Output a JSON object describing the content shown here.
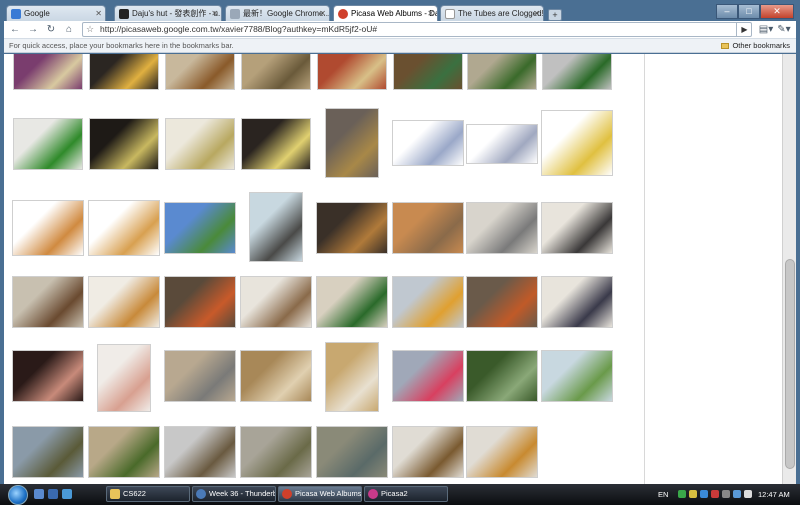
{
  "tabs": [
    {
      "label": "Google",
      "favicon_color": "#3a7bd5"
    },
    {
      "label": "Daju's hut - 發表創作 - u...",
      "favicon_color": "#222222"
    },
    {
      "label": "最新！Google Chrome...",
      "favicon_color": "#9aa8b8"
    },
    {
      "label": "Picasa Web Albums - Daj...",
      "favicon_color": "#d0402b"
    },
    {
      "label": "The Tubes are Clogged!",
      "favicon_color": "#cccccc"
    }
  ],
  "new_tab_symbol": "+",
  "window_controls": {
    "minimize": "–",
    "maximize": "□",
    "close": "✕"
  },
  "nav": {
    "back": "←",
    "forward": "→",
    "reload": "↻",
    "home": "⌂"
  },
  "omnibox": {
    "url": "http://picasaweb.google.com.tw/xavier7788/Blog?authkey=mKdR5jf2-oU#",
    "star": "☆",
    "go": "▶"
  },
  "toolbar_icons": {
    "page": "▤▾",
    "tools": "✎▾"
  },
  "bookmarks_bar": {
    "hint": "For quick access, place your bookmarks here in the bookmarks bar.",
    "other": "Other bookmarks"
  },
  "photos": [
    {
      "c1": "#7a3d6e",
      "c2": "#d8c9a0"
    },
    {
      "c1": "#2b2622",
      "c2": "#e0b040"
    },
    {
      "c1": "#c8b89c",
      "c2": "#8a5a2a"
    },
    {
      "c1": "#b5a07a",
      "c2": "#6a5a3a"
    },
    {
      "c1": "#b04a30",
      "c2": "#d8c088"
    },
    {
      "c1": "#6a5030",
      "c2": "#3a7040"
    },
    {
      "c1": "#b0a890",
      "c2": "#3a6a2a"
    },
    {
      "c1": "#c0c0c0",
      "c2": "#2a6a28"
    },
    {
      "c1": "#e8e8e4",
      "c2": "#2f8a2a"
    },
    {
      "c1": "#1e1a16",
      "c2": "#c8b860"
    },
    {
      "c1": "#ece8dc",
      "c2": "#b8a860"
    },
    {
      "c1": "#2a2420",
      "c2": "#e0d070"
    },
    {
      "c1": "#6a6058",
      "c2": "#a88848"
    },
    {
      "c1": "#ffffff",
      "c2": "#9aa8c8"
    },
    {
      "c1": "#ffffff",
      "c2": "#a0a8c0"
    },
    {
      "c1": "#ffffff",
      "c2": "#e0c040"
    },
    {
      "c1": "#ffffff",
      "c2": "#d08a40"
    },
    {
      "c1": "#ffffff",
      "c2": "#d8a050"
    },
    {
      "c1": "#5a8ad0",
      "c2": "#4a8a3a"
    },
    {
      "c1": "#c8d8e0",
      "c2": "#4a4a48"
    },
    {
      "c1": "#3a3028",
      "c2": "#b07a3a"
    },
    {
      "c1": "#c88a50",
      "c2": "#8a6a4a"
    },
    {
      "c1": "#d8d4cc",
      "c2": "#7a7a7a"
    },
    {
      "c1": "#e8e4dc",
      "c2": "#3a3838"
    },
    {
      "c1": "#c8c0b0",
      "c2": "#6a4a30"
    },
    {
      "c1": "#f0ece4",
      "c2": "#c88a3a"
    },
    {
      "c1": "#5a4a3a",
      "c2": "#c85a2a"
    },
    {
      "c1": "#e8e4dc",
      "c2": "#8a6a4a"
    },
    {
      "c1": "#d8d0c0",
      "c2": "#2a6a2a"
    },
    {
      "c1": "#c0c8d0",
      "c2": "#e0a030"
    },
    {
      "c1": "#6a5a4a",
      "c2": "#c05a28"
    },
    {
      "c1": "#e8e4dc",
      "c2": "#3a3a4a"
    },
    {
      "c1": "#2a1a18",
      "c2": "#c88a7a"
    },
    {
      "c1": "#f0ece8",
      "c2": "#d8a090"
    },
    {
      "c1": "#b8a890",
      "c2": "#7a7a78"
    },
    {
      "c1": "#a88858",
      "c2": "#e0d0b0"
    },
    {
      "c1": "#c8a870",
      "c2": "#e8e0d0"
    },
    {
      "c1": "#a0a8b8",
      "c2": "#d84060"
    },
    {
      "c1": "#3a5a2a",
      "c2": "#8aa878"
    },
    {
      "c1": "#c8d8e0",
      "c2": "#6a9a4a"
    },
    {
      "c1": "#8a9aa8",
      "c2": "#5a5a38"
    },
    {
      "c1": "#b8a888",
      "c2": "#4a6a2a"
    },
    {
      "c1": "#c8c8c8",
      "c2": "#6a5a40"
    },
    {
      "c1": "#a8a498",
      "c2": "#6a6a48"
    },
    {
      "c1": "#8a8a78",
      "c2": "#5a6a68"
    },
    {
      "c1": "#e0dcd4",
      "c2": "#7a5a30"
    },
    {
      "c1": "#e0dcd4",
      "c2": "#c88a30"
    }
  ],
  "taskbar": {
    "items": [
      {
        "label": "CS622",
        "icon_color": "#e8c35a"
      },
      {
        "label": "Week 36 - Thunderb...",
        "icon_color": "#4a7ab8"
      },
      {
        "label": "Picasa Web Albums ...",
        "icon_color": "#d0402b"
      },
      {
        "label": "Picasa2",
        "icon_color": "#c83a8a"
      }
    ],
    "lang": "EN",
    "clock": "12:47 AM"
  }
}
